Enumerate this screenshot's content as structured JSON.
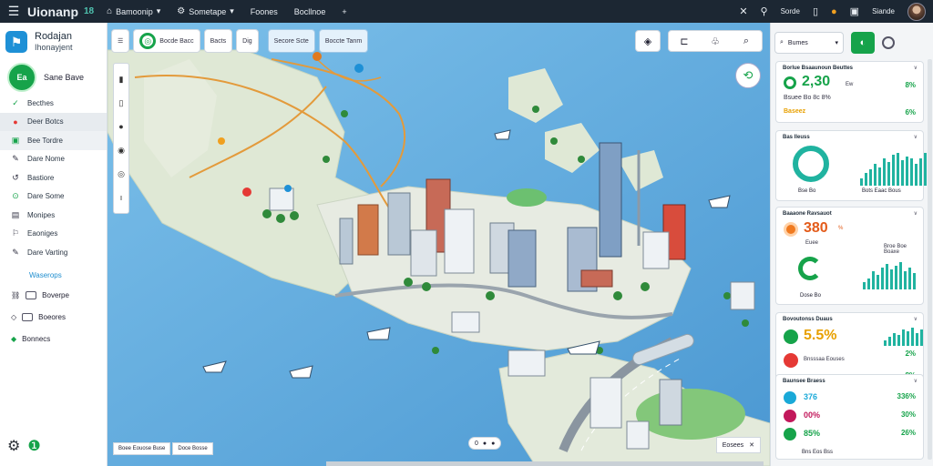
{
  "topbar": {
    "brand": "Uionanp",
    "brand_badge": "18",
    "tabs": [
      {
        "icon": "⌂",
        "label": "Bamoonip"
      },
      {
        "icon": "⚙",
        "label": "Sometape"
      },
      {
        "icon": "",
        "label": "Foones"
      },
      {
        "icon": "",
        "label": "Bocllnoe"
      }
    ],
    "right_label": "Sorde",
    "right_label2": "Siande"
  },
  "sidebar": {
    "title": "Rodajan",
    "subtitle": "Ihonayjent",
    "user_initials": "Ea",
    "user_name": "Sane Bave",
    "items": [
      {
        "label": "Becthes",
        "color": "#16a34a"
      },
      {
        "label": "Deer Botcs",
        "color": "#e53935"
      },
      {
        "label": "Bee Tordre",
        "color": "#16a34a"
      },
      {
        "label": "Dare Nome",
        "color": "#334"
      },
      {
        "label": "Bastiore",
        "color": "#334"
      },
      {
        "label": "Dare Some",
        "color": "#16a34a"
      },
      {
        "label": "Monipes",
        "color": "#334"
      },
      {
        "label": "Eaoniges",
        "color": "#334"
      },
      {
        "label": "Dare Varting",
        "color": "#334"
      }
    ],
    "section_label": "Waserops",
    "sub_items": [
      {
        "label": "Boverpe"
      },
      {
        "label": "Boeores"
      },
      {
        "label": "Bonnecs"
      }
    ]
  },
  "map": {
    "toolbar": [
      {
        "label": "Bocde Bacc",
        "kind": "plain"
      },
      {
        "label": "Bacts",
        "kind": "plain"
      },
      {
        "label": "Dig",
        "kind": "plain"
      },
      {
        "label": "Secore Scte",
        "kind": "blue"
      },
      {
        "label": "Boccte Tanm",
        "kind": "blue"
      }
    ],
    "legend": [
      "Boee Eouose Buse",
      "Doce Bosse"
    ],
    "zoom_label": "0",
    "scale_label": "Eosees"
  },
  "right_panel": {
    "search_placeholder": "Bumes",
    "cards": [
      {
        "title": "Borlue Bsaaunoun Beuttes",
        "value": "2,30",
        "value_suffix": "Ew",
        "line2": "Bsuee Bo 8c 8%",
        "line3": "Baseez",
        "pct1": "8%",
        "pct2": "6%"
      },
      {
        "title": "Bas Ileuss",
        "caption_left": "Bse Bo",
        "caption_right": "Bots Eaac Bous"
      },
      {
        "title": "Baaaone Ravsauot",
        "value": "380",
        "value_suffix": "%",
        "line2": "Euee",
        "caption_left": "Dose Bo",
        "caption_right": "Broe Boe Boaxe"
      },
      {
        "title": "Bovoutonss Duaus",
        "value": "5.5%",
        "line2": "Bnsssaa Eouses",
        "pct1": "2%",
        "pct2": "8%"
      },
      {
        "title": "Baunsee Braess",
        "rows": [
          {
            "label": "376",
            "pct": "336%",
            "color": "#1aa9d8"
          },
          {
            "label": "00%",
            "pct": "30%",
            "color": "#c2185b"
          },
          {
            "label": "85%",
            "pct": "26%",
            "color": "#16a34a"
          }
        ],
        "footer": "Bns Eos Bss"
      }
    ]
  },
  "colors": {
    "accent_green": "#16a34a",
    "accent_blue": "#1e90d6",
    "water": "#5aa8dc",
    "land": "#dfe9d8"
  }
}
